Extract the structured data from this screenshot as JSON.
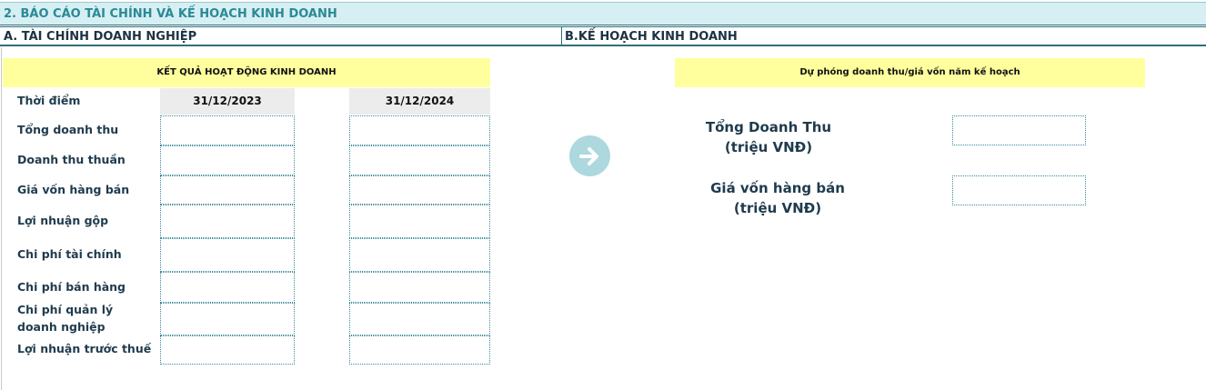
{
  "title": "2. BÁO CÁO TÀI CHÍNH VÀ KẾ HOẠCH KINH DOANH",
  "section_a": "A. TÀI CHÍNH DOANH NGHIỆP",
  "section_b": "B.KẾ HOẠCH KINH DOANH",
  "financials": {
    "header": "KẾT QUẢ HOẠT ĐỘNG KINH DOANH",
    "period_label": "Thời điểm",
    "dates": [
      "31/12/2023",
      "31/12/2024"
    ],
    "rows": [
      {
        "label": "Tổng doanh thu",
        "values": [
          "",
          ""
        ]
      },
      {
        "label": "Doanh thu thuần",
        "values": [
          "",
          ""
        ]
      },
      {
        "label": "Giá vốn hàng bán",
        "values": [
          "",
          ""
        ]
      },
      {
        "label": "Lợi nhuận gộp",
        "values": [
          "",
          ""
        ]
      },
      {
        "label": "Chi phí tài chính",
        "values": [
          "",
          ""
        ]
      },
      {
        "label": "Chi phí bán hàng",
        "values": [
          "",
          ""
        ]
      },
      {
        "label": "Chi phí quản lý doanh nghiệp",
        "values": [
          "",
          ""
        ]
      },
      {
        "label": "Lợi nhuận trước thuế",
        "values": [
          "",
          ""
        ]
      }
    ]
  },
  "plan": {
    "header": "Dự phóng doanh thu/giá vốn năm kế hoạch",
    "revenue_label_1": "Tổng Doanh Thu",
    "revenue_label_2": "(triệu VNĐ)",
    "revenue_value": "",
    "cogs_label_1": "Giá vốn hàng bán",
    "cogs_label_2": "(triệu VNĐ)",
    "cogs_value": ""
  },
  "colors": {
    "title_background": "#d6eff3",
    "title_text": "#2a8a96",
    "header_yellow": "#ffff9e",
    "arrow_circle": "#acd8de"
  },
  "icons": {
    "arrow": "arrow-right-circle-icon"
  }
}
